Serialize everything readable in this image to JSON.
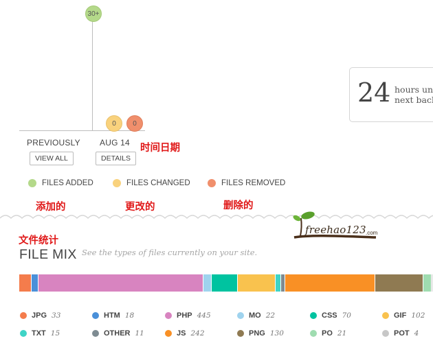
{
  "activity": {
    "top_count": "30+",
    "changed_count": "0",
    "removed_count": "0",
    "previously_label": "PREVIOUSLY",
    "view_all_label": "VIEW ALL",
    "date_label": "AUG 14",
    "details_label": "DETAILS"
  },
  "legend": {
    "added": "FILES ADDED",
    "changed": "FILES CHANGED",
    "removed": "FILES REMOVED",
    "colors": {
      "added": "#b4d98a",
      "changed": "#f9d27d",
      "removed": "#f08f6c"
    }
  },
  "annotations": {
    "date": "时间日期",
    "added": "添加的",
    "changed": "更改的",
    "removed": "删除的",
    "file_mix": "文件统计"
  },
  "countdown": {
    "number": "24",
    "line1": "hours unt",
    "line2": "next back"
  },
  "logo": {
    "brand": "freehao123",
    "suffix": ".com"
  },
  "file_mix": {
    "title": "FILE MIX",
    "subtitle": "See the types of files currently on your site.",
    "types": [
      {
        "name": "JPG",
        "count": "33",
        "value": 33,
        "color": "#f47c4c"
      },
      {
        "name": "HTM",
        "count": "18",
        "value": 18,
        "color": "#4a90d9"
      },
      {
        "name": "PHP",
        "count": "445",
        "value": 445,
        "color": "#d884c0"
      },
      {
        "name": "MO",
        "count": "22",
        "value": 22,
        "color": "#9fd3ee"
      },
      {
        "name": "CSS",
        "count": "70",
        "value": 70,
        "color": "#00c3a0"
      },
      {
        "name": "GIF",
        "count": "102",
        "value": 102,
        "color": "#f9c24e"
      },
      {
        "name": "TXT",
        "count": "15",
        "value": 15,
        "color": "#3fd4c6"
      },
      {
        "name": "OTHER",
        "count": "11",
        "value": 11,
        "color": "#7e8b92"
      },
      {
        "name": "JS",
        "count": "242",
        "value": 242,
        "color": "#f99025"
      },
      {
        "name": "PNG",
        "count": "130",
        "value": 130,
        "color": "#8f7a52"
      },
      {
        "name": "PO",
        "count": "21",
        "value": 21,
        "color": "#9fdcb0"
      },
      {
        "name": "POT",
        "count": "4",
        "value": 4,
        "color": "#c7c7c7"
      }
    ]
  }
}
